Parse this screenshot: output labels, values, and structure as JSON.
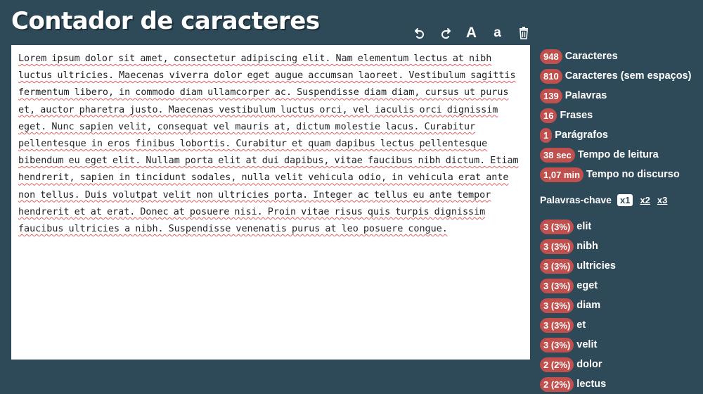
{
  "header": {
    "title": "Contador de caracteres"
  },
  "toolbar": {
    "undo_icon": "undo-icon",
    "redo_icon": "redo-icon",
    "uppercase_label": "A",
    "lowercase_label": "a",
    "trash_icon": "trash-icon"
  },
  "editor": {
    "text": "Lorem ipsum dolor sit amet, consectetur adipiscing elit. Nam elementum lectus at nibh luctus ultricies. Maecenas viverra dolor eget augue accumsan laoreet. Vestibulum sagittis fermentum libero, in commodo diam ullamcorper ac. Suspendisse diam diam, cursus ut purus et, auctor pharetra justo. Maecenas vestibulum luctus orci, vel iaculis orci dignissim eget. Nunc sapien velit, consequat vel mauris at, dictum molestie lacus. Curabitur pellentesque in eros finibus lobortis. Curabitur et quam dapibus lectus pellentesque bibendum eu eget elit. Nullam porta elit at dui dapibus, vitae faucibus nibh dictum. Etiam hendrerit, sapien in tincidunt sodales, nulla velit vehicula odio, in vehicula erat ante non tellus. Duis volutpat velit non ultricies porta. Integer ac tellus eu ante tempor hendrerit et at erat. Donec at posuere nisi. Proin vitae risus quis turpis dignissim faucibus ultricies a nibh. Suspendisse venenatis purus at leo posuere congue."
  },
  "stats": [
    {
      "value": "948",
      "label": "Caracteres"
    },
    {
      "value": "810",
      "label": "Caracteres (sem espaços)"
    },
    {
      "value": "139",
      "label": "Palavras"
    },
    {
      "value": "16",
      "label": "Frases"
    },
    {
      "value": "1",
      "label": "Parágrafos"
    },
    {
      "value": "38 sec",
      "label": "Tempo de leitura"
    },
    {
      "value": "1,07 min",
      "label": "Tempo no discurso"
    }
  ],
  "keywords": {
    "title": "Palavras-chave",
    "options": [
      "x1",
      "x2",
      "x3"
    ],
    "active_option": "x1",
    "items": [
      {
        "count": "3 (3%)",
        "word": "elit"
      },
      {
        "count": "3 (3%)",
        "word": "nibh"
      },
      {
        "count": "3 (3%)",
        "word": "ultricies"
      },
      {
        "count": "3 (3%)",
        "word": "eget"
      },
      {
        "count": "3 (3%)",
        "word": "diam"
      },
      {
        "count": "3 (3%)",
        "word": "et"
      },
      {
        "count": "3 (3%)",
        "word": "velit"
      },
      {
        "count": "2 (2%)",
        "word": "dolor"
      },
      {
        "count": "2 (2%)",
        "word": "lectus"
      }
    ]
  },
  "colors": {
    "background": "#2e4a59",
    "pill": "#c0504d",
    "editor_bg": "#ffffff",
    "spellcheck": "#e06060"
  }
}
